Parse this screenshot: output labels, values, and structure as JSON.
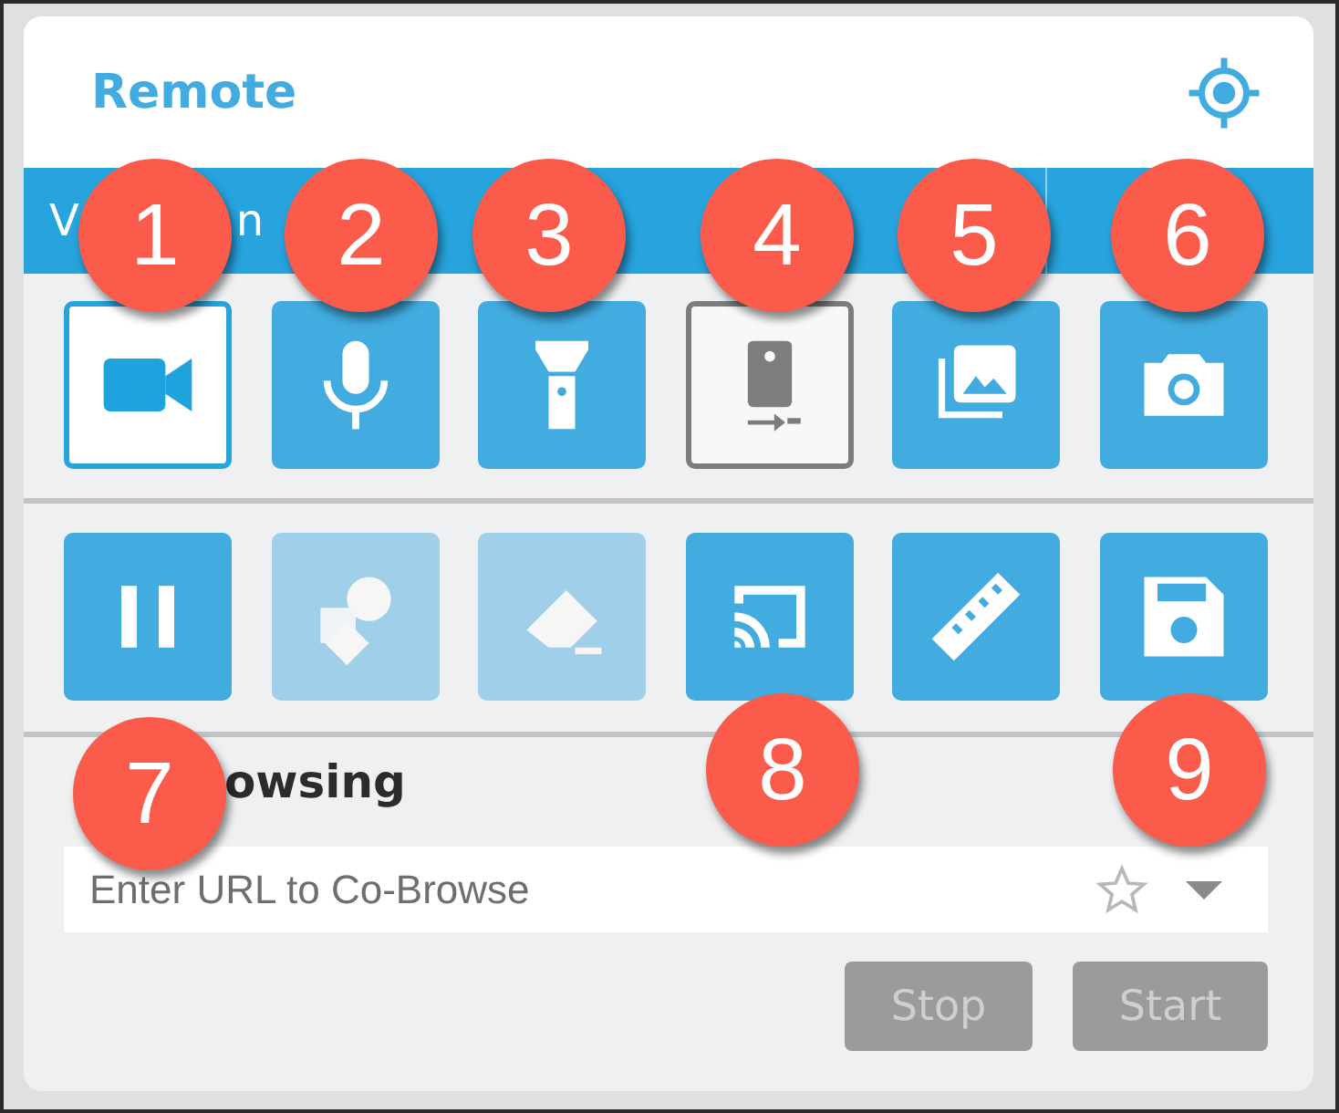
{
  "header": {
    "title": "Remote"
  },
  "bar": {
    "fragments": [
      "V",
      "n"
    ]
  },
  "tool_rows": [
    [
      {
        "kind": "video",
        "selected": true,
        "on": false,
        "disabled": false
      },
      {
        "kind": "mic",
        "selected": false,
        "on": false,
        "disabled": false
      },
      {
        "kind": "flashlight",
        "selected": false,
        "on": false,
        "disabled": false
      },
      {
        "kind": "device",
        "selected": false,
        "on": true,
        "disabled": false
      },
      {
        "kind": "gallery",
        "selected": false,
        "on": false,
        "disabled": false
      },
      {
        "kind": "camera",
        "selected": false,
        "on": false,
        "disabled": false
      }
    ],
    [
      {
        "kind": "pause",
        "selected": false,
        "on": false,
        "disabled": false
      },
      {
        "kind": "shapes",
        "selected": false,
        "on": false,
        "disabled": true
      },
      {
        "kind": "eraser",
        "selected": false,
        "on": false,
        "disabled": true
      },
      {
        "kind": "cast",
        "selected": false,
        "on": false,
        "disabled": false
      },
      {
        "kind": "ruler",
        "selected": false,
        "on": false,
        "disabled": false
      },
      {
        "kind": "save",
        "selected": false,
        "on": false,
        "disabled": false
      }
    ]
  ],
  "cobrowse": {
    "heading": "owsing",
    "url_field": {
      "placeholder": "Enter URL to Co-Browse"
    },
    "buttons": [
      "Stop",
      "Start"
    ]
  },
  "callouts": [
    "1",
    "2",
    "3",
    "4",
    "5",
    "6",
    "7",
    "8",
    "9"
  ]
}
